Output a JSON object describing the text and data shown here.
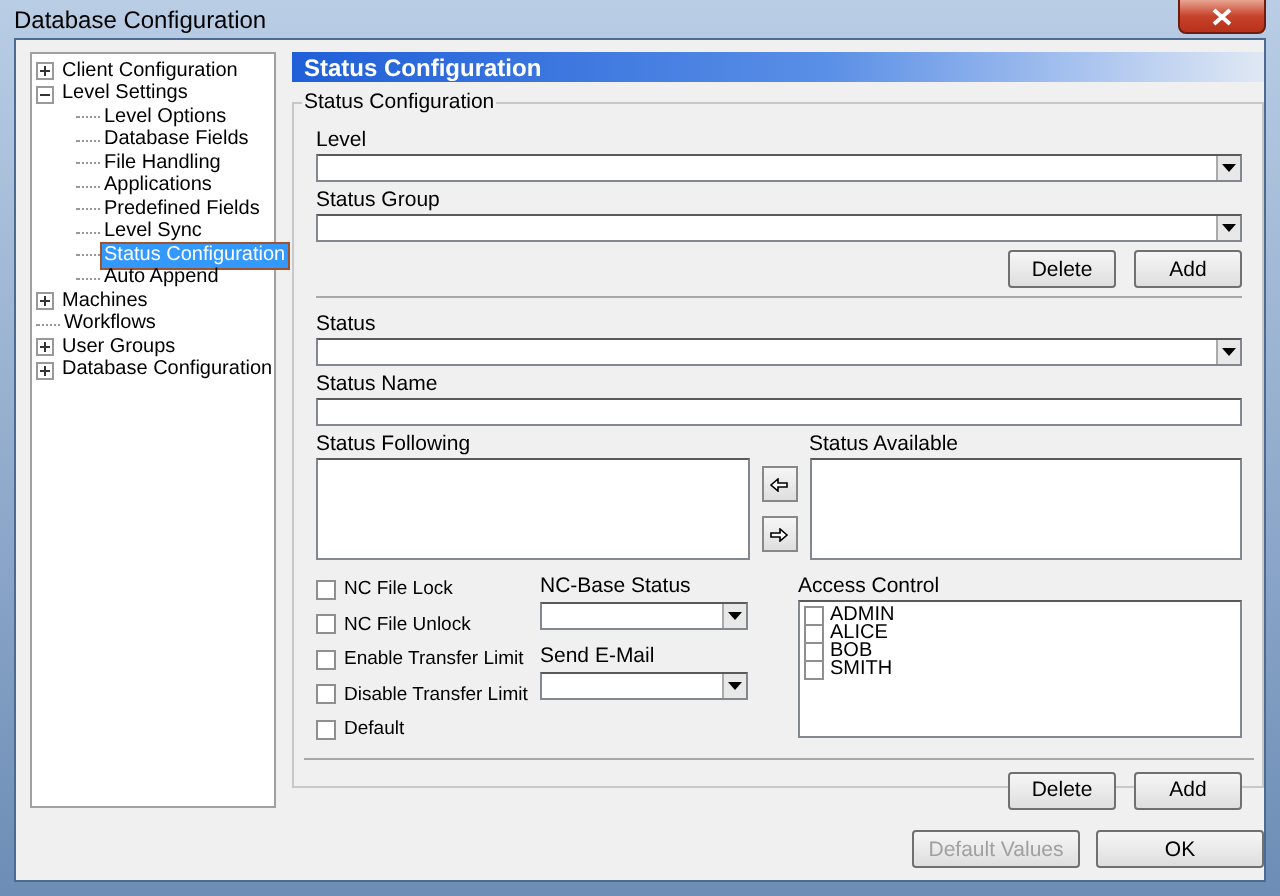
{
  "window": {
    "title": "Database Configuration"
  },
  "tree": [
    {
      "label": "Client Configuration",
      "expanded": false,
      "selected": false,
      "has_children": true
    },
    {
      "label": "Level Settings",
      "expanded": true,
      "selected": false,
      "has_children": true,
      "children": [
        {
          "label": "Level Options",
          "selected": false
        },
        {
          "label": "Database Fields",
          "selected": false
        },
        {
          "label": "File Handling",
          "selected": false
        },
        {
          "label": "Applications",
          "selected": false
        },
        {
          "label": "Predefined Fields",
          "selected": false
        },
        {
          "label": "Level Sync",
          "selected": false
        },
        {
          "label": "Status Configuration",
          "selected": true
        },
        {
          "label": "Auto Append",
          "selected": false
        }
      ]
    },
    {
      "label": "Machines",
      "expanded": false,
      "selected": false,
      "has_children": true
    },
    {
      "label": "Workflows",
      "selected": false,
      "has_children": false
    },
    {
      "label": "User Groups",
      "expanded": false,
      "selected": false,
      "has_children": true
    },
    {
      "label": "Database Configuration",
      "expanded": false,
      "selected": false,
      "has_children": true
    }
  ],
  "header": {
    "title": "Status Configuration"
  },
  "group": {
    "title": "Status Configuration",
    "level": {
      "label": "Level"
    },
    "status_group": {
      "label": "Status Group"
    },
    "group_buttons": [
      "Delete",
      "Add"
    ],
    "status": {
      "label": "Status"
    },
    "status_name": {
      "label": "Status Name"
    },
    "status_following": {
      "label": "Status Following"
    },
    "status_available": {
      "label": "Status Available"
    },
    "options": [
      {
        "label": "NC File Lock",
        "checked": false
      },
      {
        "label": "NC File Unlock",
        "checked": false
      },
      {
        "label": "Enable Transfer Limit",
        "checked": false
      },
      {
        "label": "Disable Transfer Limit",
        "checked": false
      },
      {
        "label": "Default",
        "checked": false
      }
    ],
    "nc_base_status": {
      "label": "NC-Base Status"
    },
    "send_email": {
      "label": "Send E-Mail"
    },
    "access_control": {
      "label": "Access Control",
      "users": [
        {
          "name": "ADMIN",
          "checked": false
        },
        {
          "name": "ALICE",
          "checked": false
        },
        {
          "name": "BOB",
          "checked": false
        },
        {
          "name": "SMITH",
          "checked": false
        }
      ]
    },
    "status_buttons": [
      "Delete",
      "Add"
    ]
  },
  "footer": {
    "buttons": [
      {
        "label": "Default Values",
        "disabled": true
      },
      {
        "label": "OK",
        "disabled": false
      }
    ]
  }
}
